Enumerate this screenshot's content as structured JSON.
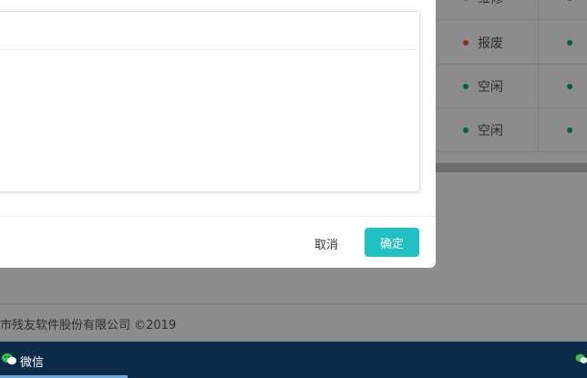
{
  "table": {
    "rows": [
      {
        "status": "维修",
        "dot_color": "#f0a020",
        "dot2_color": "#19a974"
      },
      {
        "status": "报废",
        "dot_color": "#e8603c",
        "dot2_color": "#19a974"
      },
      {
        "status": "空闲",
        "dot_color": "#19a974",
        "dot2_color": "#19a974"
      },
      {
        "status": "空闲",
        "dot_color": "#19a974",
        "dot2_color": "#19a974"
      }
    ]
  },
  "footer": {
    "copyright": "市残友软件股份有限公司 ©2019"
  },
  "modal": {
    "cancel_label": "取消",
    "ok_label": "确定",
    "ok_color": "#23c0c3"
  },
  "taskbar": {
    "app_label": "微信",
    "app_icon": "wechat-icon",
    "tray_icon": "wechat-tray-icon"
  }
}
